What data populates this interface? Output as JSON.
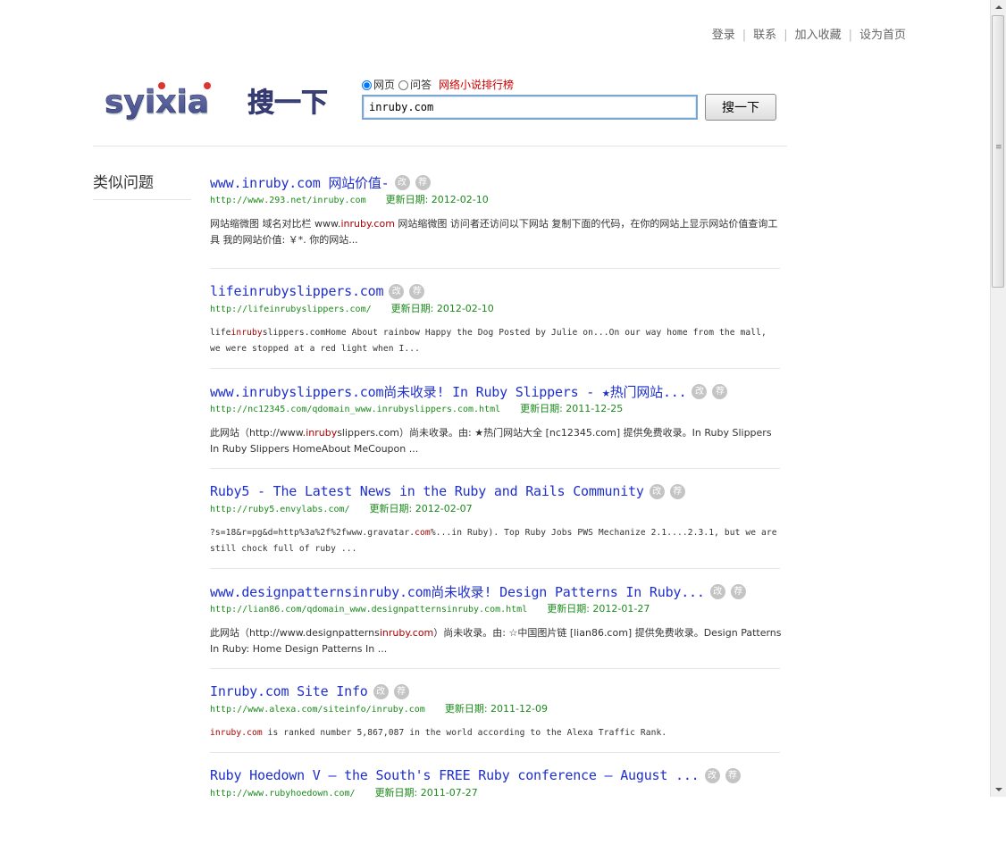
{
  "topnav": {
    "login": "登录",
    "contact": "联系",
    "favorite": "加入收藏",
    "homepage": "设为首页"
  },
  "logo": {
    "text": "syixia",
    "subtitle": "搜一下"
  },
  "search": {
    "radio_web": "网页",
    "radio_qa": "问答",
    "rank_link": "网络小说排行榜",
    "query": "inruby.com",
    "button": "搜一下"
  },
  "sidebar": {
    "title": "类似问题"
  },
  "badges": {
    "edit": "改",
    "recommend": "荐"
  },
  "results": [
    {
      "title": "www.inruby.com 网站价值-",
      "url": "http://www.293.net/inruby.com",
      "date": "更新日期: 2012-02-10",
      "desc_pre": "网站缩微图 域名对比栏 www.",
      "desc_hl": "inruby.com",
      "desc_post": " 网站缩微图 访问者还访问以下网站 复制下面的代码，在你的网站上显示网站价值查询工具 我的网站价值: ￥*. 你的网站..."
    },
    {
      "title": "lifeinrubyslippers.com",
      "url": "http://lifeinrubyslippers.com/",
      "date": "更新日期: 2012-02-10",
      "desc_pre": "life",
      "desc_hl": "inruby",
      "desc_post": "slippers.comHome About rainbow Happy the Dog Posted by Julie on...On our way home from the mall, we were stopped at a red light when I..."
    },
    {
      "title": "www.inrubyslippers.com尚未收录! In Ruby Slippers - ★热门网站...",
      "url": "http://nc12345.com/qdomain_www.inrubyslippers.com.html",
      "date": "更新日期: 2011-12-25",
      "desc_pre": "此网站（http://www.",
      "desc_hl": "inruby",
      "desc_post": "slippers.com）尚未收录。由: ★热门网站大全 [nc12345.com] 提供免费收录。In Ruby Slippers In Ruby Slippers HomeAbout MeCoupon ..."
    },
    {
      "title": "Ruby5 - The Latest News in the Ruby and Rails Community",
      "url": "http://ruby5.envylabs.com/",
      "date": "更新日期: 2012-02-07",
      "desc_pre": "?s=18&r=pg&d=http%3a%2f%2fwww.gravatar.",
      "desc_hl": "com",
      "desc_post": "%...in Ruby). Top Ruby Jobs PWS Mechanize 2.1....2.3.1, but we are still chock full of ruby ..."
    },
    {
      "title": "www.designpatternsinruby.com尚未收录! Design Patterns In Ruby...",
      "url": "http://lian86.com/qdomain_www.designpatternsinruby.com.html",
      "date": "更新日期: 2012-01-27",
      "desc_pre": "此网站（http://www.designpatterns",
      "desc_hl": "inruby.com",
      "desc_post": "）尚未收录。由: ☆中国图片链 [lian86.com] 提供免费收录。Design Patterns In Ruby: Home Design Patterns In ..."
    },
    {
      "title": "Inruby.com Site Info",
      "url": "http://www.alexa.com/siteinfo/inruby.com",
      "date": "更新日期: 2011-12-09",
      "desc_pre": "",
      "desc_hl": "inruby.com",
      "desc_post": " is ranked number 5,867,087 in the world according to the Alexa Traffic Rank."
    },
    {
      "title": "Ruby Hoedown V — the South's FREE Ruby conference — August ...",
      "url": "http://www.rubyhoedown.com/",
      "date": "更新日期: 2011-07-27",
      "desc_pre": "",
      "desc_hl": "",
      "desc_post": ""
    }
  ]
}
